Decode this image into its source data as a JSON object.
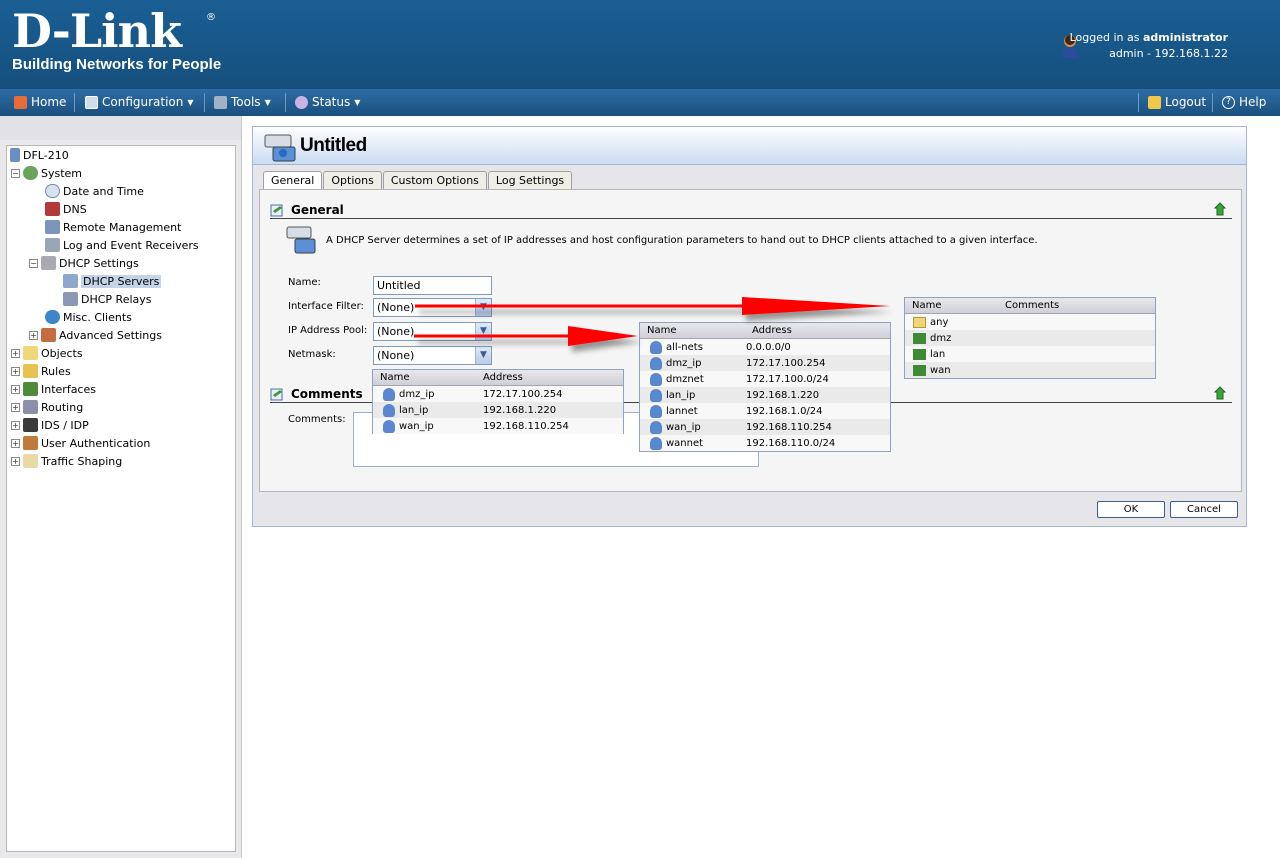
{
  "header": {
    "brand": "D-Link",
    "brand_mark": "®",
    "tagline": "Building Networks for People",
    "login_prefix": "Logged in as",
    "login_user": "administrator",
    "login_detail": "admin - 192.168.1.22"
  },
  "menu": {
    "home": "Home",
    "configuration": "Configuration",
    "tools": "Tools",
    "status": "Status",
    "logout": "Logout",
    "help": "Help"
  },
  "tree": {
    "root": "DFL-210",
    "system": "System",
    "date_time": "Date and Time",
    "dns": "DNS",
    "remote_mgmt": "Remote Management",
    "log_receivers": "Log and Event Receivers",
    "dhcp_settings": "DHCP Settings",
    "dhcp_servers": "DHCP Servers",
    "dhcp_relays": "DHCP Relays",
    "misc_clients": "Misc. Clients",
    "advanced": "Advanced Settings",
    "objects": "Objects",
    "rules": "Rules",
    "interfaces": "Interfaces",
    "routing": "Routing",
    "ids": "IDS / IDP",
    "user_auth": "User Authentication",
    "traffic": "Traffic Shaping"
  },
  "panel": {
    "title": "Untitled",
    "tabs": [
      "General",
      "Options",
      "Custom Options",
      "Log Settings"
    ],
    "general_heading": "General",
    "description": "A DHCP Server determines a set of IP addresses and host configuration parameters to hand out to DHCP clients attached to a given interface.",
    "name_label": "Name:",
    "name_value": "Untitled",
    "interface_filter_label": "Interface Filter:",
    "interface_filter_value": "(None)",
    "ip_pool_label": "IP Address Pool:",
    "ip_pool_value": "(None)",
    "netmask_label": "Netmask:",
    "netmask_value": "(None)",
    "comments_heading": "Comments",
    "comments_label": "Comments:",
    "ok": "OK",
    "cancel": "Cancel"
  },
  "popups": {
    "interfaces": {
      "headers": [
        "Name",
        "Comments"
      ],
      "rows": [
        {
          "name": "any",
          "comment": ""
        },
        {
          "name": "dmz",
          "comment": ""
        },
        {
          "name": "lan",
          "comment": ""
        },
        {
          "name": "wan",
          "comment": ""
        }
      ]
    },
    "address_pool": {
      "headers": [
        "Name",
        "Address"
      ],
      "rows": [
        {
          "name": "all-nets",
          "address": "0.0.0.0/0"
        },
        {
          "name": "dmz_ip",
          "address": "172.17.100.254"
        },
        {
          "name": "dmznet",
          "address": "172.17.100.0/24"
        },
        {
          "name": "lan_ip",
          "address": "192.168.1.220"
        },
        {
          "name": "lannet",
          "address": "192.168.1.0/24"
        },
        {
          "name": "wan_ip",
          "address": "192.168.110.254"
        },
        {
          "name": "wannet",
          "address": "192.168.110.0/24"
        }
      ]
    },
    "netmask": {
      "headers": [
        "Name",
        "Address"
      ],
      "rows": [
        {
          "name": "dmz_ip",
          "address": "172.17.100.254"
        },
        {
          "name": "lan_ip",
          "address": "192.168.1.220"
        },
        {
          "name": "wan_ip",
          "address": "192.168.110.254"
        }
      ]
    }
  },
  "colors": {
    "header_bg": "#1a5f93",
    "menubar_bg": "#2d6ea5",
    "panel_header_bg": "#cbdcf3",
    "annotation_arrow": "#ff0000"
  }
}
